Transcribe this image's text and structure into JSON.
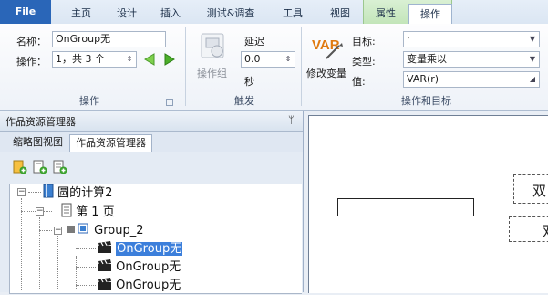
{
  "tabs": [
    "File",
    "主页",
    "设计",
    "插入",
    "测试&调查",
    "工具",
    "视图",
    "属性",
    "操作"
  ],
  "ops_group": {
    "name_label": "名称：",
    "name_value": "OnGroup无",
    "action_label": "操作：",
    "action_value": "1，共 3 个",
    "caption": "操作"
  },
  "trigger_group": {
    "button_label": "操作组",
    "delay_label": "延迟",
    "delay_value": "0.0",
    "seconds_label": "秒",
    "caption": "触发"
  },
  "target_group": {
    "var_icon_text": "VAR",
    "modify_label": "修改变量",
    "target_label": "目标:",
    "target_value": "r",
    "type_label": "类型:",
    "type_value": "变量乘以",
    "value_label": "值:",
    "value_value": "VAR(r)",
    "caption": "操作和目标"
  },
  "pane": {
    "title": "作品资源管理器",
    "pin": "ᛘ",
    "subtab_thumb": "缩略图视图",
    "subtab_explorer": "作品资源管理器"
  },
  "tree": {
    "root": "圆的计算2",
    "page": "第 1 页",
    "group": "Group_2",
    "items": [
      "OnGroup无",
      "OnGroup无",
      "OnGroup无"
    ]
  },
  "canvas": {
    "box1_text": "双",
    "box2_text": "双"
  },
  "colors": {
    "accent": "#2a66b8",
    "selection": "#3c7fdb",
    "context_tab": "#c3e5ba",
    "play_green": "#4caf2a"
  }
}
